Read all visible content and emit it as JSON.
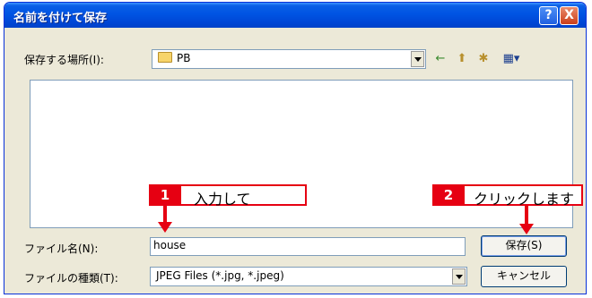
{
  "window": {
    "title": "名前を付けて保存",
    "help_label": "?",
    "close_label": "X"
  },
  "save_in": {
    "label": "保存する場所(I):",
    "value": "PB"
  },
  "toolbar": {
    "back_glyph": "←",
    "up_glyph": "⬆",
    "new_folder_glyph": "✱",
    "view_glyph": "▦▾"
  },
  "file_name": {
    "label": "ファイル名(N):",
    "value": "house"
  },
  "file_type": {
    "label": "ファイルの種類(T):",
    "value": "JPEG Files (*.jpg, *.jpeg)"
  },
  "buttons": {
    "save": "保存(S)",
    "cancel": "キャンセル"
  },
  "callouts": [
    {
      "number": "1",
      "text": "入力して"
    },
    {
      "number": "2",
      "text": "クリックします"
    }
  ],
  "colors": {
    "callout": "#e60012",
    "titlebar": "#0054e3"
  }
}
